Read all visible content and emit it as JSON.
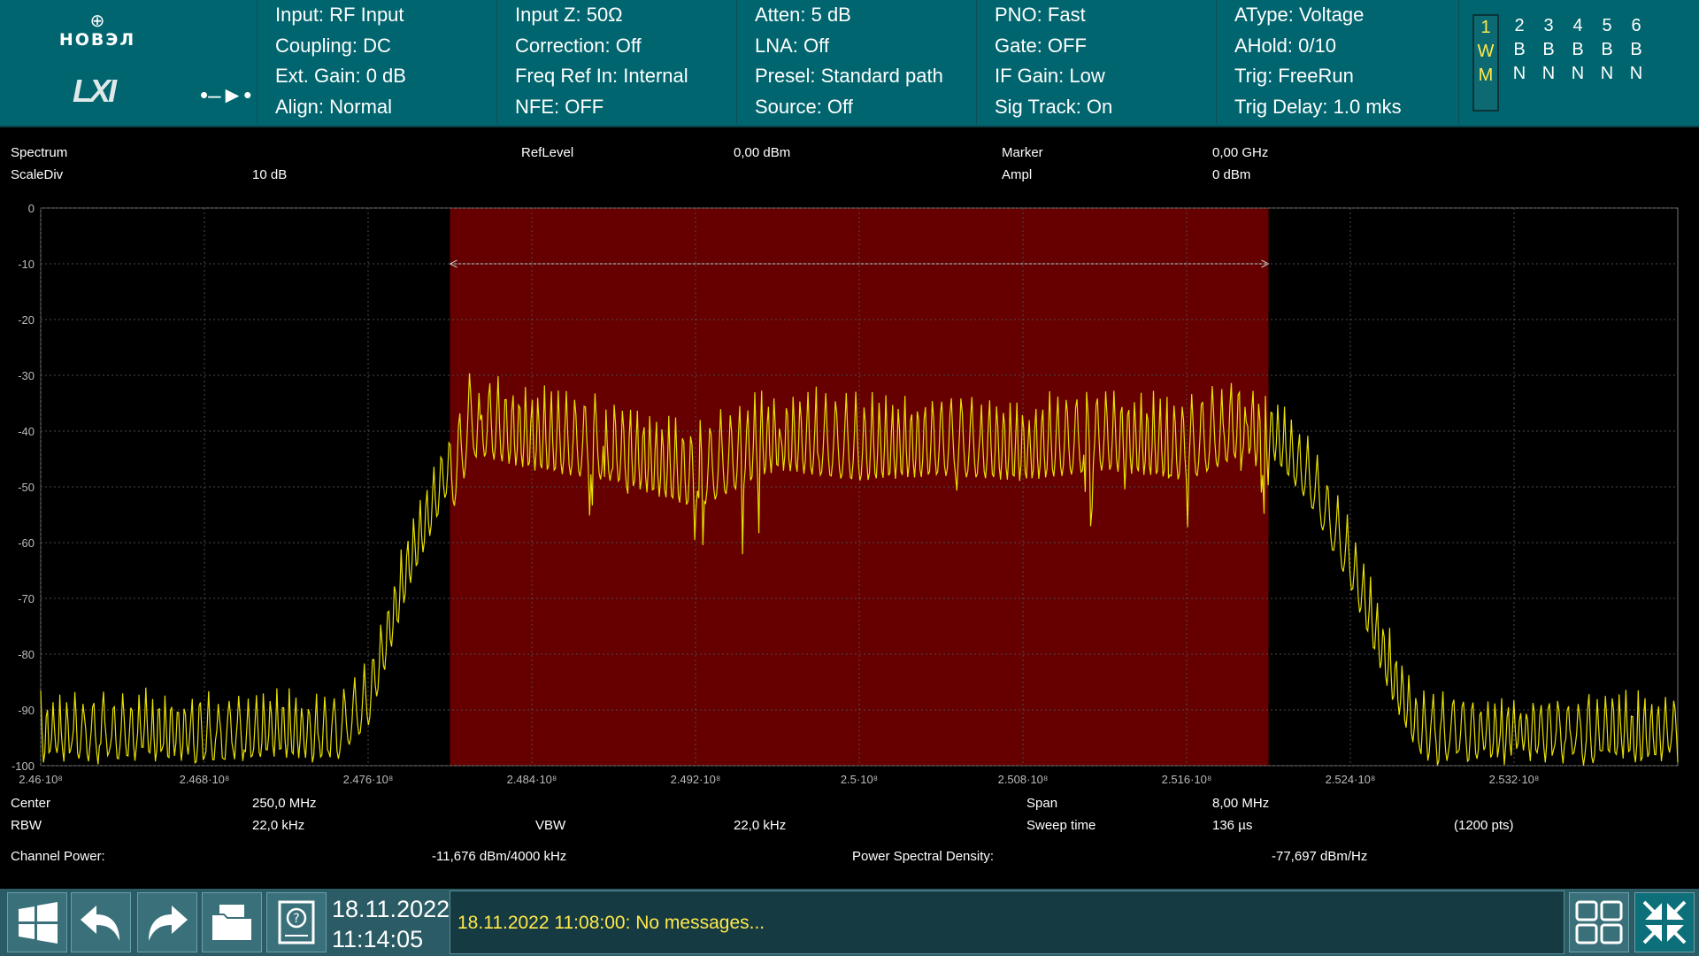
{
  "brand": {
    "name": "НОВЭЛ",
    "lxi": "LXI"
  },
  "params": [
    [
      "Input: RF Input",
      "Coupling: DC",
      "Ext. Gain: 0 dB",
      "Align: Normal"
    ],
    [
      "Input Z: 50Ω",
      "Correction: Off",
      "Freq Ref In: Internal",
      "NFE: OFF"
    ],
    [
      "Atten: 5 dB",
      "LNA: Off",
      "Presel: Standard path",
      "Source: Off"
    ],
    [
      "PNO: Fast",
      "Gate: OFF",
      "IF Gain: Low",
      "Sig Track: On"
    ],
    [
      "AType: Voltage",
      "AHold: 0/10",
      "Trig: FreeRun",
      "Trig Delay: 1.0 mks"
    ]
  ],
  "traces": [
    {
      "n": "1",
      "a": "W",
      "b": "M",
      "active": true
    },
    {
      "n": "2",
      "a": "B",
      "b": "N",
      "active": false
    },
    {
      "n": "3",
      "a": "B",
      "b": "N",
      "active": false
    },
    {
      "n": "4",
      "a": "B",
      "b": "N",
      "active": false
    },
    {
      "n": "5",
      "a": "B",
      "b": "N",
      "active": false
    },
    {
      "n": "6",
      "a": "B",
      "b": "N",
      "active": false
    }
  ],
  "header": {
    "mode": "Spectrum",
    "scalediv_label": "ScaleDiv",
    "scalediv": "10 dB",
    "reflevel_label": "RefLevel",
    "reflevel": "0,00 dBm",
    "marker_label": "Marker",
    "marker": "0,00 GHz",
    "ampl_label": "Ampl",
    "ampl": "0 dBm"
  },
  "footer": {
    "center_label": "Center",
    "center": "250,0 MHz",
    "rbw_label": "RBW",
    "rbw": "22,0 kHz",
    "vbw_label": "VBW",
    "vbw": "22,0 kHz",
    "span_label": "Span",
    "span": "8,00 MHz",
    "sweep_label": "Sweep time",
    "sweep": "136 µs",
    "points": "(1200 pts)",
    "chpower_label": "Channel Power:",
    "chpower": "-11,676 dBm/4000 kHz",
    "psd_label": "Power Spectral Density:",
    "psd": "-77,697 dBm/Hz"
  },
  "status": {
    "date": "18.11.2022",
    "time": "11:14:05",
    "message": "18.11.2022 11:08:00: No messages..."
  },
  "colors": {
    "trace": "#e8e000",
    "channel_band": "#660000",
    "topbar": "#00656e"
  },
  "chart_data": {
    "type": "line",
    "x_range": [
      246000000,
      254000000
    ],
    "ylim": [
      -100,
      0
    ],
    "grid": true,
    "y_ticks": [
      "0",
      "-10",
      "-20",
      "-30",
      "-40",
      "-50",
      "-60",
      "-70",
      "-80",
      "-90",
      "-100"
    ],
    "x_ticks": [
      "2.46·10⁸",
      "2.468·10⁸",
      "2.476·10⁸",
      "2.484·10⁸",
      "2.492·10⁸",
      "2.5·10⁸",
      "2.508·10⁸",
      "2.516·10⁸",
      "2.524·10⁸",
      "2.532·10⁸"
    ],
    "x_tick_values": [
      246000000,
      246800000,
      247600000,
      248400000,
      249200000,
      250000000,
      250800000,
      251600000,
      252400000,
      253200000
    ],
    "channel_band": [
      248000000,
      252000000
    ],
    "series": [
      {
        "x": [
          246000000,
          246400000,
          246800000,
          247200000,
          247400000,
          247600000,
          247800000,
          248000000,
          248100000,
          248400000,
          248800000,
          249200000,
          249600000,
          250000000,
          250400000,
          250800000,
          251200000,
          251600000,
          251900000,
          252000000,
          252200000,
          252400000,
          252600000,
          252800000,
          253200000,
          253600000,
          254000000
        ],
        "y": [
          -95,
          -93,
          -95,
          -95,
          -92,
          -85,
          -60,
          -42,
          -30,
          -33,
          -35,
          -40,
          -33,
          -35,
          -34,
          -35,
          -33,
          -35,
          -30,
          -36,
          -45,
          -60,
          -80,
          -95,
          -94,
          -95,
          -94
        ]
      }
    ]
  }
}
